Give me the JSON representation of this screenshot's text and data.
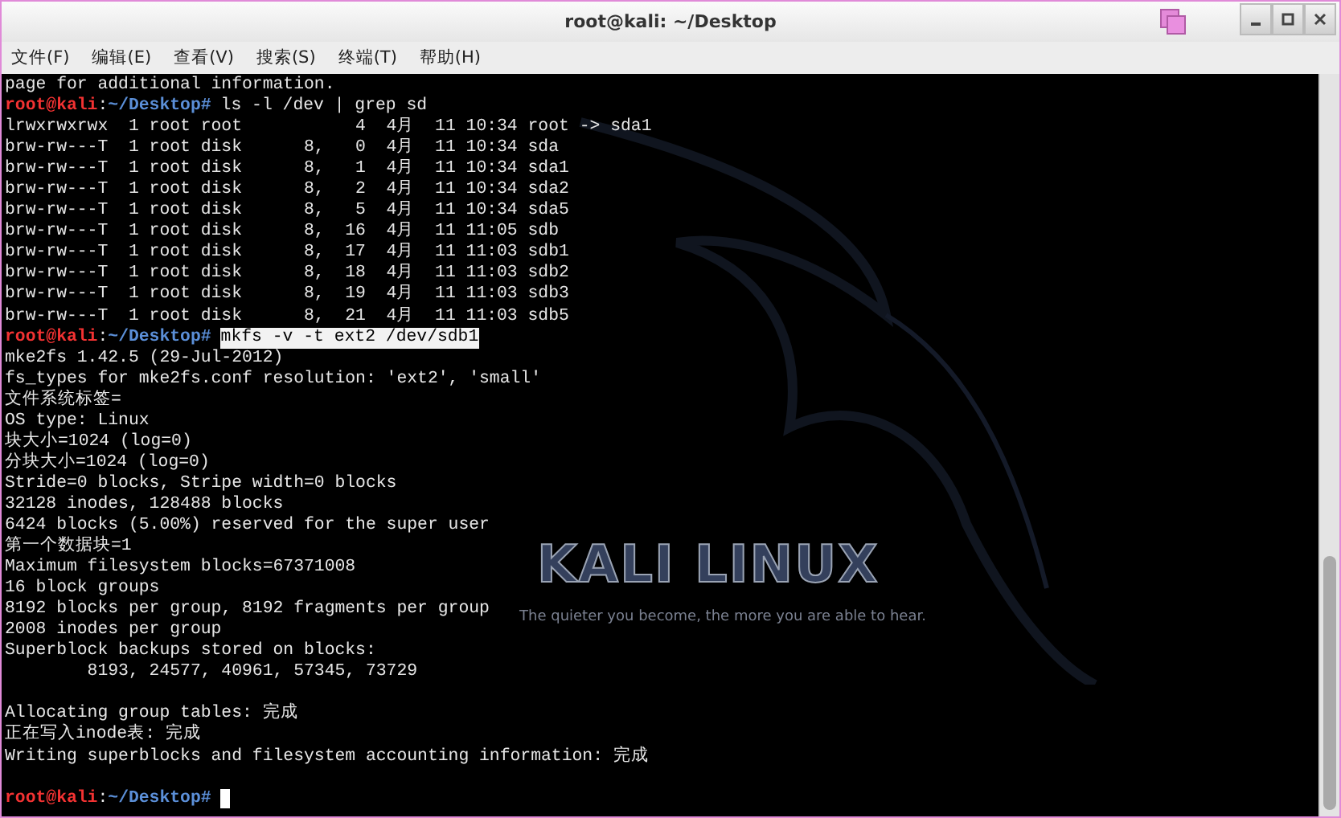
{
  "window": {
    "title": "root@kali: ~/Desktop"
  },
  "menu": [
    {
      "label": "文件(F)"
    },
    {
      "label": "编辑(E)"
    },
    {
      "label": "查看(V)"
    },
    {
      "label": "搜索(S)"
    },
    {
      "label": "终端(T)"
    },
    {
      "label": "帮助(H)"
    }
  ],
  "wallpaper": {
    "logo": "KALI LINUX",
    "tagline": "The quieter you become, the more you are able to hear."
  },
  "lines": [
    {
      "kind": "output",
      "text": "page for additional information."
    },
    {
      "kind": "prompt",
      "user": "root@kali",
      "sep": ":",
      "path": "~/Desktop#",
      "command": "ls -l /dev | grep sd",
      "selected": false
    },
    {
      "kind": "output",
      "text": "lrwxrwxrwx  1 root root           4  4月  11 10:34 root -> sda1"
    },
    {
      "kind": "output",
      "text": "brw-rw---T  1 root disk      8,   0  4月  11 10:34 sda"
    },
    {
      "kind": "output",
      "text": "brw-rw---T  1 root disk      8,   1  4月  11 10:34 sda1"
    },
    {
      "kind": "output",
      "text": "brw-rw---T  1 root disk      8,   2  4月  11 10:34 sda2"
    },
    {
      "kind": "output",
      "text": "brw-rw---T  1 root disk      8,   5  4月  11 10:34 sda5"
    },
    {
      "kind": "output",
      "text": "brw-rw---T  1 root disk      8,  16  4月  11 11:05 sdb"
    },
    {
      "kind": "output",
      "text": "brw-rw---T  1 root disk      8,  17  4月  11 11:03 sdb1"
    },
    {
      "kind": "output",
      "text": "brw-rw---T  1 root disk      8,  18  4月  11 11:03 sdb2"
    },
    {
      "kind": "output",
      "text": "brw-rw---T  1 root disk      8,  19  4月  11 11:03 sdb3"
    },
    {
      "kind": "output",
      "text": "brw-rw---T  1 root disk      8,  21  4月  11 11:03 sdb5"
    },
    {
      "kind": "prompt",
      "user": "root@kali",
      "sep": ":",
      "path": "~/Desktop#",
      "command": "mkfs -v -t ext2 /dev/sdb1",
      "selected": true
    },
    {
      "kind": "output",
      "text": "mke2fs 1.42.5 (29-Jul-2012)"
    },
    {
      "kind": "output",
      "text": "fs_types for mke2fs.conf resolution: 'ext2', 'small'"
    },
    {
      "kind": "output",
      "text": "文件系统标签="
    },
    {
      "kind": "output",
      "text": "OS type: Linux"
    },
    {
      "kind": "output",
      "text": "块大小=1024 (log=0)"
    },
    {
      "kind": "output",
      "text": "分块大小=1024 (log=0)"
    },
    {
      "kind": "output",
      "text": "Stride=0 blocks, Stripe width=0 blocks"
    },
    {
      "kind": "output",
      "text": "32128 inodes, 128488 blocks"
    },
    {
      "kind": "output",
      "text": "6424 blocks (5.00%) reserved for the super user"
    },
    {
      "kind": "output",
      "text": "第一个数据块=1"
    },
    {
      "kind": "output",
      "text": "Maximum filesystem blocks=67371008"
    },
    {
      "kind": "output",
      "text": "16 block groups"
    },
    {
      "kind": "output",
      "text": "8192 blocks per group, 8192 fragments per group"
    },
    {
      "kind": "output",
      "text": "2008 inodes per group"
    },
    {
      "kind": "output",
      "text": "Superblock backups stored on blocks:"
    },
    {
      "kind": "output",
      "text": "        8193, 24577, 40961, 57345, 73729"
    },
    {
      "kind": "blank"
    },
    {
      "kind": "output",
      "text": "Allocating group tables: 完成"
    },
    {
      "kind": "output",
      "text": "正在写入inode表: 完成"
    },
    {
      "kind": "output",
      "text": "Writing superblocks and filesystem accounting information: 完成"
    },
    {
      "kind": "blank"
    },
    {
      "kind": "prompt",
      "user": "root@kali",
      "sep": ":",
      "path": "~/Desktop#",
      "cursor": true
    }
  ]
}
